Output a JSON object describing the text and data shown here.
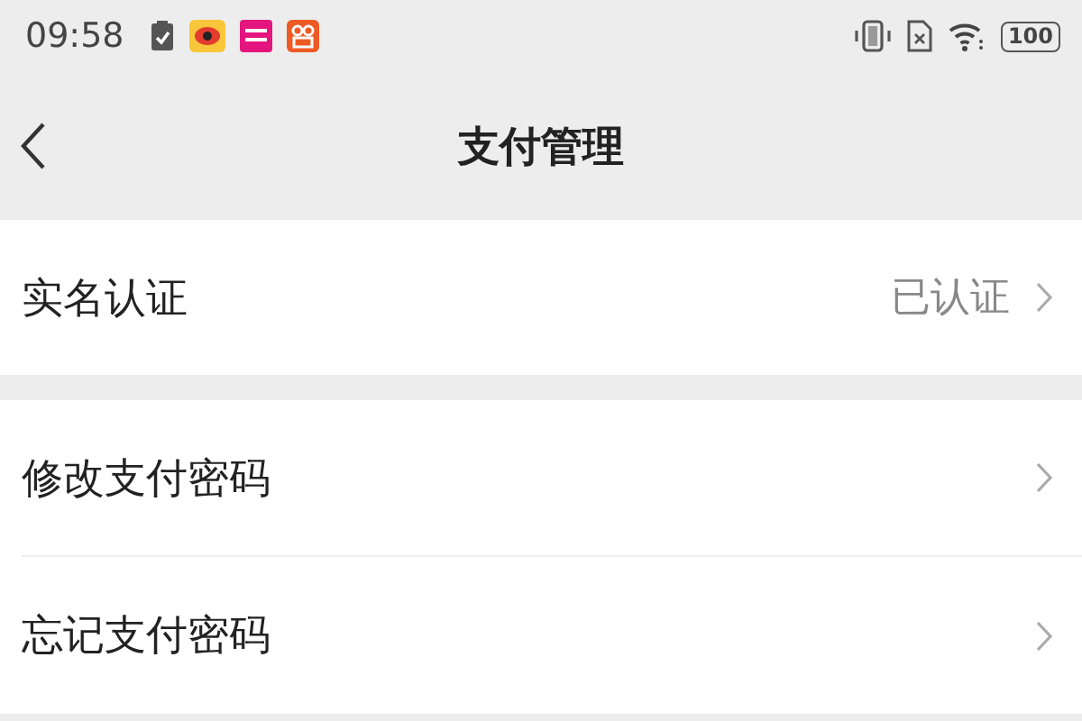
{
  "status_bar": {
    "time": "09:58",
    "battery": "100"
  },
  "nav": {
    "title": "支付管理"
  },
  "sections": [
    {
      "rows": [
        {
          "label": "实名认证",
          "value": "已认证"
        }
      ]
    },
    {
      "rows": [
        {
          "label": "修改支付密码"
        },
        {
          "label": "忘记支付密码"
        }
      ]
    }
  ]
}
